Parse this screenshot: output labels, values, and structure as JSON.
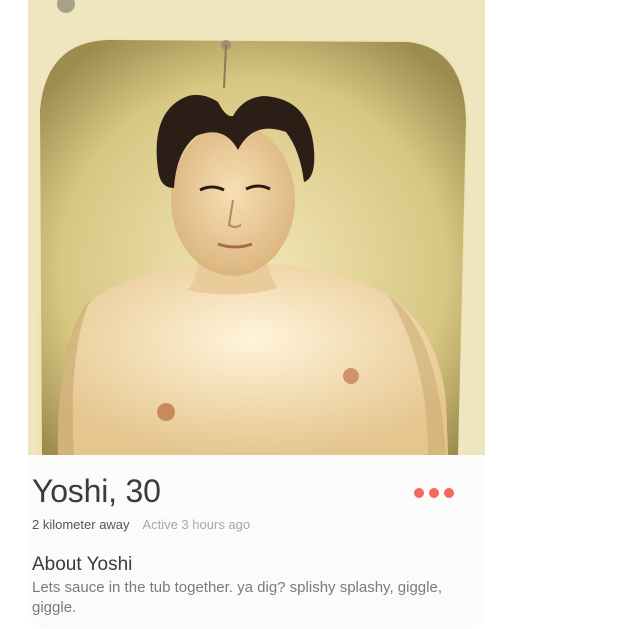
{
  "profile": {
    "name": "Yoshi",
    "age_display": "30",
    "distance": "2 kilometer away",
    "active": "Active 3 hours ago",
    "about_title": "About Yoshi",
    "about_text": "Lets sauce in the tub together. ya dig? splishy splashy, giggle, giggle."
  },
  "icons": {
    "more": "more-options-icon"
  },
  "colors": {
    "accent": "#f0695a",
    "name_text": "#3b3b3b",
    "secondary_text": "#7b7b7b",
    "muted_text": "#a8a8a8"
  }
}
